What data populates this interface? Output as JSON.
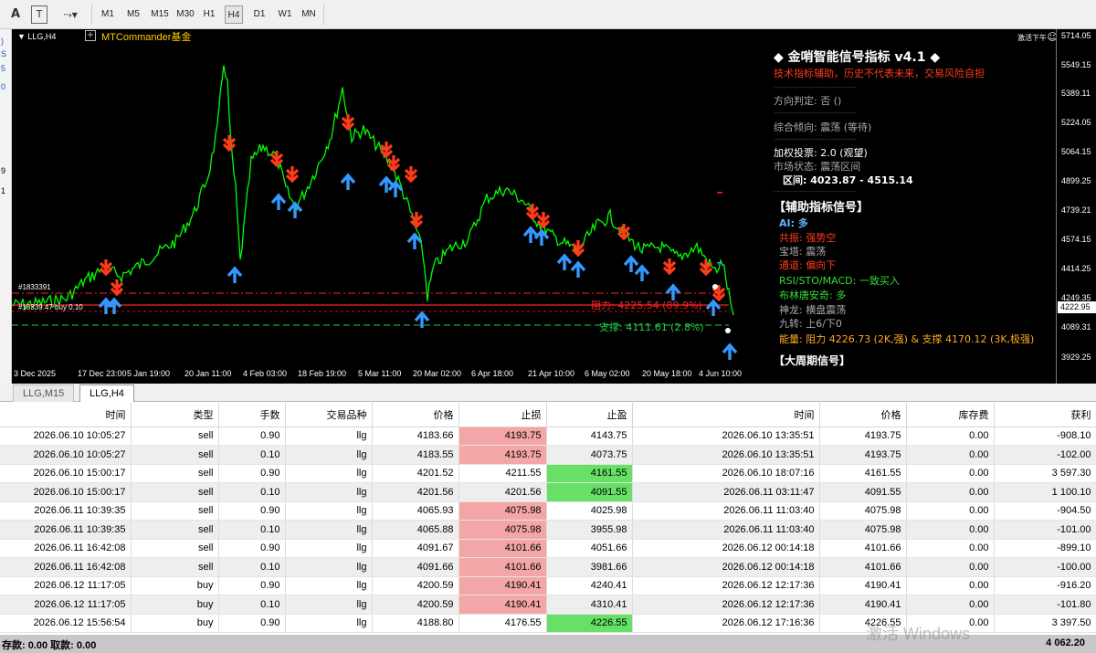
{
  "toolbar": {
    "icons": [
      "text-A-icon",
      "text-label-icon",
      "shapes-icon"
    ],
    "timeframes": [
      "M1",
      "M5",
      "M15",
      "M30",
      "H1",
      "H4",
      "D1",
      "W1",
      "MN"
    ],
    "active_timeframe": "H4"
  },
  "left_strip": {
    "marks": [
      ")",
      "S",
      "5",
      "0",
      "9",
      "1"
    ]
  },
  "chart": {
    "symbol": "LLG,H4",
    "ea_name": "MTCommander基金",
    "corner_label": "激活下午",
    "corner_icon": "smiley-icon",
    "price_labels": [
      "5714.05",
      "5549.15",
      "5389.11",
      "5224.05",
      "5064.15",
      "4899.25",
      "4739.21",
      "4574.15",
      "4414.25",
      "4249.35",
      "4089.31",
      "3929.25"
    ],
    "current_price": "4222.95",
    "time_labels": [
      "3 Dec 2025",
      "17 Dec 23:00",
      "5 Jan 19:00",
      "20 Jan 11:00",
      "4 Feb 03:00",
      "18 Feb 19:00",
      "5 Mar 11:00",
      "20 Mar 02:00",
      "6 Apr 18:00",
      "21 Apr 10:00",
      "6 May 02:00",
      "20 May 18:00",
      "4 Jun 10:00"
    ],
    "order_labels": [
      "#1833391",
      "#18339.47 buy 0.10"
    ],
    "resistance_line_label": "阻力: 4225.54 (89.9%)",
    "support_line_label": "支撑: 4111.61 (2.8%)",
    "colors": {
      "candle_up": "#00ff00",
      "arrow_sell": "#ff3b1a",
      "arrow_buy": "#3399ff",
      "resistance": "#ff2222",
      "support": "#22cc44"
    }
  },
  "panel": {
    "title": "◆ 金哨智能信号指标 v4.1 ◆",
    "disclaimer": "技术指标辅助，历史不代表未来，交易风险自担",
    "separator": "------------------------------------",
    "direction": "方向判定: 否 ()",
    "tendency": "综合倾向: 震荡 (等待)",
    "weighted_vote": "加权投票: 2.0 (观望)",
    "market_state": "市场状态: 震荡区间",
    "range": "区间: 4023.87 - 4515.14",
    "aux_header": "【辅助指标信号】",
    "ai": "AI: 多",
    "resonance": "共振: 强势空",
    "baota": "宝塔: 震荡",
    "channel": "通道: 偏向下",
    "rsi": "RSI/STO/MACD: 一致买入",
    "boll": "布林唐安奇: 多",
    "shenlong": "神龙: 横盘震荡",
    "jiuzhuan": "九转: 上6/下0",
    "energy": "能量: 阻力 4226.73 (2K,强) & 支撑 4170.12 (3K,极强)",
    "bottom_header": "【大周期信号】"
  },
  "tabs": [
    {
      "label": "LLG,M15",
      "active": false
    },
    {
      "label": "LLG,H4",
      "active": true
    }
  ],
  "table": {
    "headers": [
      "时间",
      "类型",
      "手数",
      "交易品种",
      "价格",
      "止损",
      "止盈",
      "时间",
      "价格",
      "库存费",
      "获利"
    ],
    "rows": [
      [
        "2026.06.10 10:05:27",
        "sell",
        "0.90",
        "llg",
        "4183.66",
        "4193.75",
        "4143.75",
        "2026.06.10 13:35:51",
        "4193.75",
        "0.00",
        "-908.10"
      ],
      [
        "2026.06.10 10:05:27",
        "sell",
        "0.10",
        "llg",
        "4183.55",
        "4193.75",
        "4073.75",
        "2026.06.10 13:35:51",
        "4193.75",
        "0.00",
        "-102.00"
      ],
      [
        "2026.06.10 15:00:17",
        "sell",
        "0.90",
        "llg",
        "4201.52",
        "4211.55",
        "4161.55",
        "2026.06.10 18:07:16",
        "4161.55",
        "0.00",
        "3 597.30"
      ],
      [
        "2026.06.10 15:00:17",
        "sell",
        "0.10",
        "llg",
        "4201.56",
        "4201.56",
        "4091.55",
        "2026.06.11 03:11:47",
        "4091.55",
        "0.00",
        "1 100.10"
      ],
      [
        "2026.06.11 10:39:35",
        "sell",
        "0.90",
        "llg",
        "4065.93",
        "4075.98",
        "4025.98",
        "2026.06.11 11:03:40",
        "4075.98",
        "0.00",
        "-904.50"
      ],
      [
        "2026.06.11 10:39:35",
        "sell",
        "0.10",
        "llg",
        "4065.88",
        "4075.98",
        "3955.98",
        "2026.06.11 11:03:40",
        "4075.98",
        "0.00",
        "-101.00"
      ],
      [
        "2026.06.11 16:42:08",
        "sell",
        "0.90",
        "llg",
        "4091.67",
        "4101.66",
        "4051.66",
        "2026.06.12 00:14:18",
        "4101.66",
        "0.00",
        "-899.10"
      ],
      [
        "2026.06.11 16:42:08",
        "sell",
        "0.10",
        "llg",
        "4091.66",
        "4101.66",
        "3981.66",
        "2026.06.12 00:14:18",
        "4101.66",
        "0.00",
        "-100.00"
      ],
      [
        "2026.06.12 11:17:05",
        "buy",
        "0.90",
        "llg",
        "4200.59",
        "4190.41",
        "4240.41",
        "2026.06.12 12:17:36",
        "4190.41",
        "0.00",
        "-916.20"
      ],
      [
        "2026.06.12 11:17:05",
        "buy",
        "0.10",
        "llg",
        "4200.59",
        "4190.41",
        "4310.41",
        "2026.06.12 12:17:36",
        "4190.41",
        "0.00",
        "-101.80"
      ],
      [
        "2026.06.12 15:56:54",
        "buy",
        "0.90",
        "llg",
        "4188.80",
        "4176.55",
        "4226.55",
        "2026.06.12 17:16:36",
        "4226.55",
        "0.00",
        "3 397.50"
      ]
    ],
    "sl_hit_rows": [
      0,
      1,
      4,
      5,
      6,
      7,
      8,
      9
    ],
    "tp_hit_rows": [
      2,
      3,
      10
    ]
  },
  "footer": {
    "left": "存款: 0.00  取款: 0.00",
    "right": "4 062.20"
  },
  "watermark": "激活 Windows"
}
